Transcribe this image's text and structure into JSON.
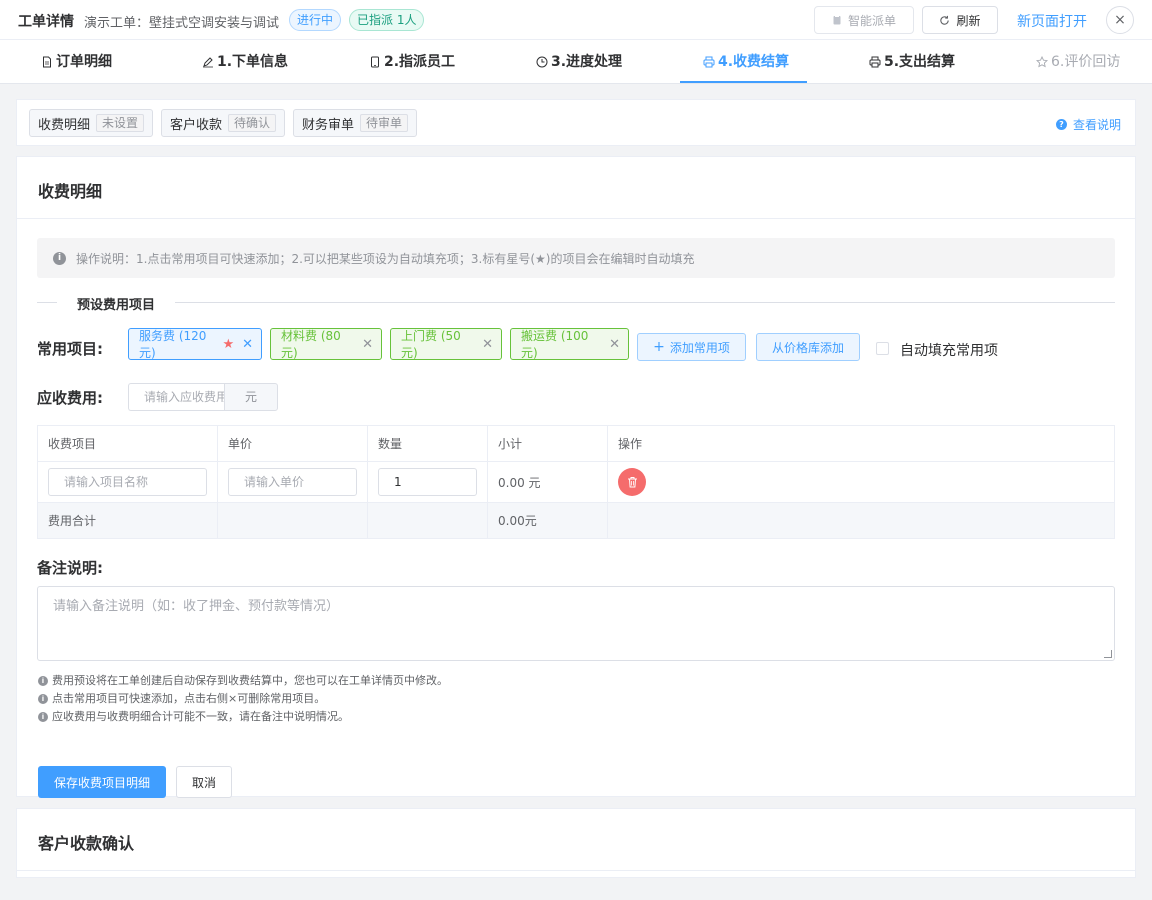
{
  "header": {
    "title": "工单详情",
    "subtitle": "演示工单：壁挂式空调安装与调试",
    "status_tag": "进行中",
    "assign_tag": "已指派 1人",
    "smart_dispatch": "智能派单",
    "refresh": "刷新",
    "open_new_page": "新页面打开",
    "close": "×"
  },
  "steps": [
    {
      "label": "订单明细",
      "icon": "document-icon"
    },
    {
      "label": "1.下单信息",
      "icon": "edit-icon"
    },
    {
      "label": "2.指派员工",
      "icon": "phone-icon"
    },
    {
      "label": "3.进度处理",
      "icon": "clock-icon"
    },
    {
      "label": "4.收费结算",
      "icon": "printer-icon",
      "active": true
    },
    {
      "label": "5.支出结算",
      "icon": "printer-icon"
    },
    {
      "label": "6.评价回访",
      "icon": "star-icon",
      "disabled": true
    }
  ],
  "statusbar": {
    "items": [
      {
        "label": "收费明细",
        "badge": "未设置"
      },
      {
        "label": "客户收款",
        "badge": "待确认"
      },
      {
        "label": "财务审单",
        "badge": "待审单"
      }
    ],
    "help": "查看说明"
  },
  "fee_card": {
    "title": "收费明细",
    "info": "操作说明：1.点击常用项目可快速添加；2.可以把某些项设为自动填充项；3.标有星号(★)的项目会在编辑时自动填充",
    "preset_title": "预设费用项目",
    "common_label": "常用项目:",
    "chips": [
      {
        "label": "服务费 (120元)",
        "star": true,
        "color": "blue"
      },
      {
        "label": "材料费 (80元)",
        "color": "green"
      },
      {
        "label": "上门费 (50元)",
        "color": "green"
      },
      {
        "label": "搬运费 (100元)",
        "color": "green"
      }
    ],
    "add_common": "添加常用项",
    "from_price_lib": "从价格库添加",
    "auto_fill_label": "自动填充常用项",
    "receivable_label": "应收费用:",
    "receivable_placeholder": "请输入应收费用",
    "receivable_unit": "元",
    "table": {
      "headers": [
        "收费项目",
        "单价",
        "数量",
        "小计",
        "操作"
      ],
      "row": {
        "name_placeholder": "请输入项目名称",
        "price_placeholder": "请输入单价",
        "qty": "1",
        "subtotal": "0.00 元"
      },
      "total_label": "费用合计",
      "total_value": "0.00元"
    },
    "remark_label": "备注说明:",
    "remark_placeholder": "请输入备注说明（如：收了押金、预付款等情况）",
    "notes": [
      "费用预设将在工单创建后自动保存到收费结算中，您也可以在工单详情页中修改。",
      "点击常用项目可快速添加，点击右侧×可删除常用项目。",
      "应收费用与收费明细合计可能不一致，请在备注中说明情况。"
    ],
    "save_button": "保存收费项目明细",
    "cancel_button": "取消"
  },
  "payment_card": {
    "title": "客户收款确认"
  },
  "colors": {
    "primary": "#409eff",
    "success": "#67c23a",
    "danger": "#f56c6c",
    "teal": "#1a9f7f"
  }
}
